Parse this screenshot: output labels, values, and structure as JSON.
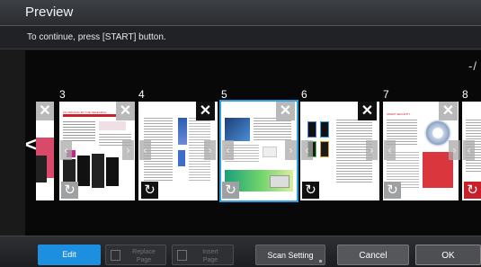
{
  "window": {
    "title": "Preview"
  },
  "message": "To continue, press [START] button.",
  "page_counter": "-/",
  "pages": [
    {
      "number": "3"
    },
    {
      "number": "4"
    },
    {
      "number": "5"
    },
    {
      "number": "6"
    },
    {
      "number": "7"
    },
    {
      "number": "8"
    }
  ],
  "page_art_text": {
    "p3_headline": "AN ORIGINAL BY THE RESEARCH",
    "p7_headline": "SMART SECURITY"
  },
  "toolbar": {
    "edit": "Edit",
    "replace_line1": "Replace",
    "replace_line2": "Page",
    "insert_line1": "Insert",
    "insert_line2": "Page",
    "scan_setting": "Scan Setting",
    "cancel": "Cancel",
    "ok": "OK"
  },
  "colors": {
    "accent": "#1d8fe0",
    "rotate_red": "#c8202a"
  }
}
